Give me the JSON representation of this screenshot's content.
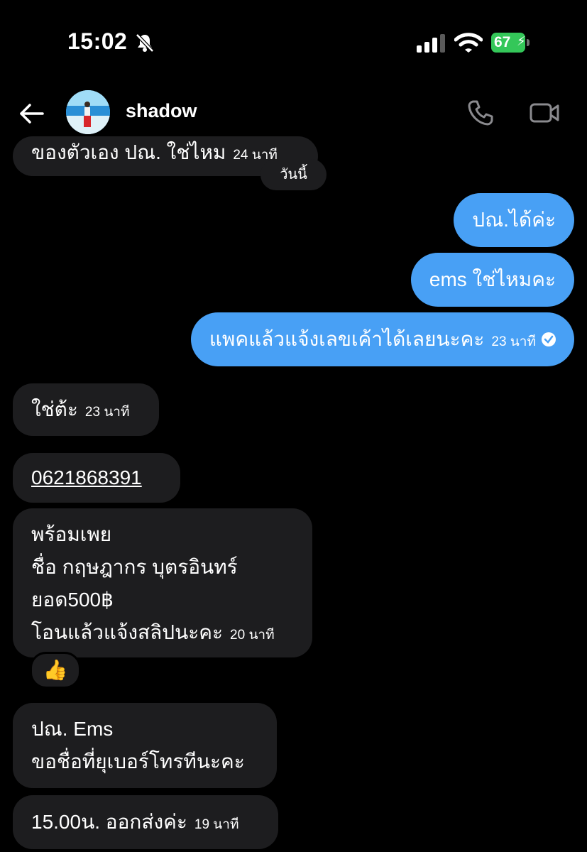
{
  "status_bar": {
    "time": "15:02",
    "battery": "67"
  },
  "header": {
    "username": "shadow"
  },
  "messages": {
    "m1": {
      "text": "ของตัวเอง ปณ. ใช่ไหม",
      "time": "24 นาที"
    },
    "date_separator": "วันนี้",
    "m2": {
      "text": "ปณ.ได้ค่ะ"
    },
    "m3": {
      "text": "ems ใช่ไหมคะ"
    },
    "m4": {
      "text": "แพคแล้วแจ้งเลขเค้าได้เลยนะคะ",
      "time": "23 นาที"
    },
    "m5": {
      "text": "ใช่ต้ะ",
      "time": "23 นาที"
    },
    "m6": {
      "text": "0621868391"
    },
    "m7": {
      "line1": "พร้อมเพย",
      "line2": "ชื่อ กฤษฎากร บุตรอินทร์",
      "line3": "ยอด500฿",
      "line4": "โอนแล้วแจ้งสลิปนะคะ",
      "time": "20 นาที",
      "reaction": "👍"
    },
    "m8": {
      "line1": "ปณ. Ems",
      "line2": "ขอชื่อที่ยุเบอร์โทรทีนะคะ"
    },
    "m9": {
      "text": "15.00น. ออกส่งค่ะ",
      "time": "19 นาที"
    }
  },
  "colors": {
    "outgoing": "#48a0f5",
    "incoming": "#1d1d1f",
    "battery": "#34c759"
  }
}
